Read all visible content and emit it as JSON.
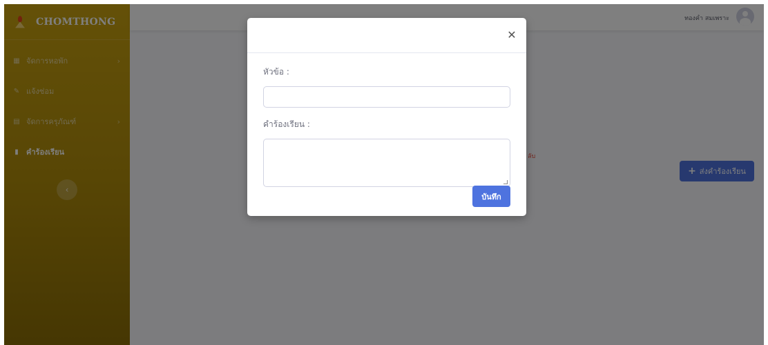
{
  "app": {
    "brand_name": "CHOMTHONG"
  },
  "sidebar": {
    "items": [
      {
        "label": "จัดการหอพัก",
        "icon": "building-icon",
        "has_submenu": true
      },
      {
        "label": "แจ้งซ่อม",
        "icon": "wrench-icon",
        "has_submenu": false
      },
      {
        "label": "จัดการครุภัณฑ์",
        "icon": "table-icon",
        "has_submenu": true
      },
      {
        "label": "คำร้องเรียน",
        "icon": "file-icon",
        "active": true
      }
    ],
    "collapse_icon": "chevron-left-icon"
  },
  "topbar": {
    "user_name": "ทองคำ สมเพราะ",
    "avatar_icon": "user-circle-icon"
  },
  "main": {
    "partial_text": "ลับ",
    "send_button_label": "ส่งคำร้องเรียน",
    "send_button_icon": "plus-icon"
  },
  "modal": {
    "close_icon": "close-icon",
    "title_label": "หัวข้อ :",
    "title_value": "",
    "complaint_label": "คำร้องเรียน :",
    "complaint_value": "",
    "save_label": "บันทึก"
  },
  "colors": {
    "sidebar_gradient_top": "#c9a210",
    "sidebar_gradient_bottom": "#8c6e06",
    "primary_button": "#4e73df",
    "danger_text": "#e74a3b"
  }
}
